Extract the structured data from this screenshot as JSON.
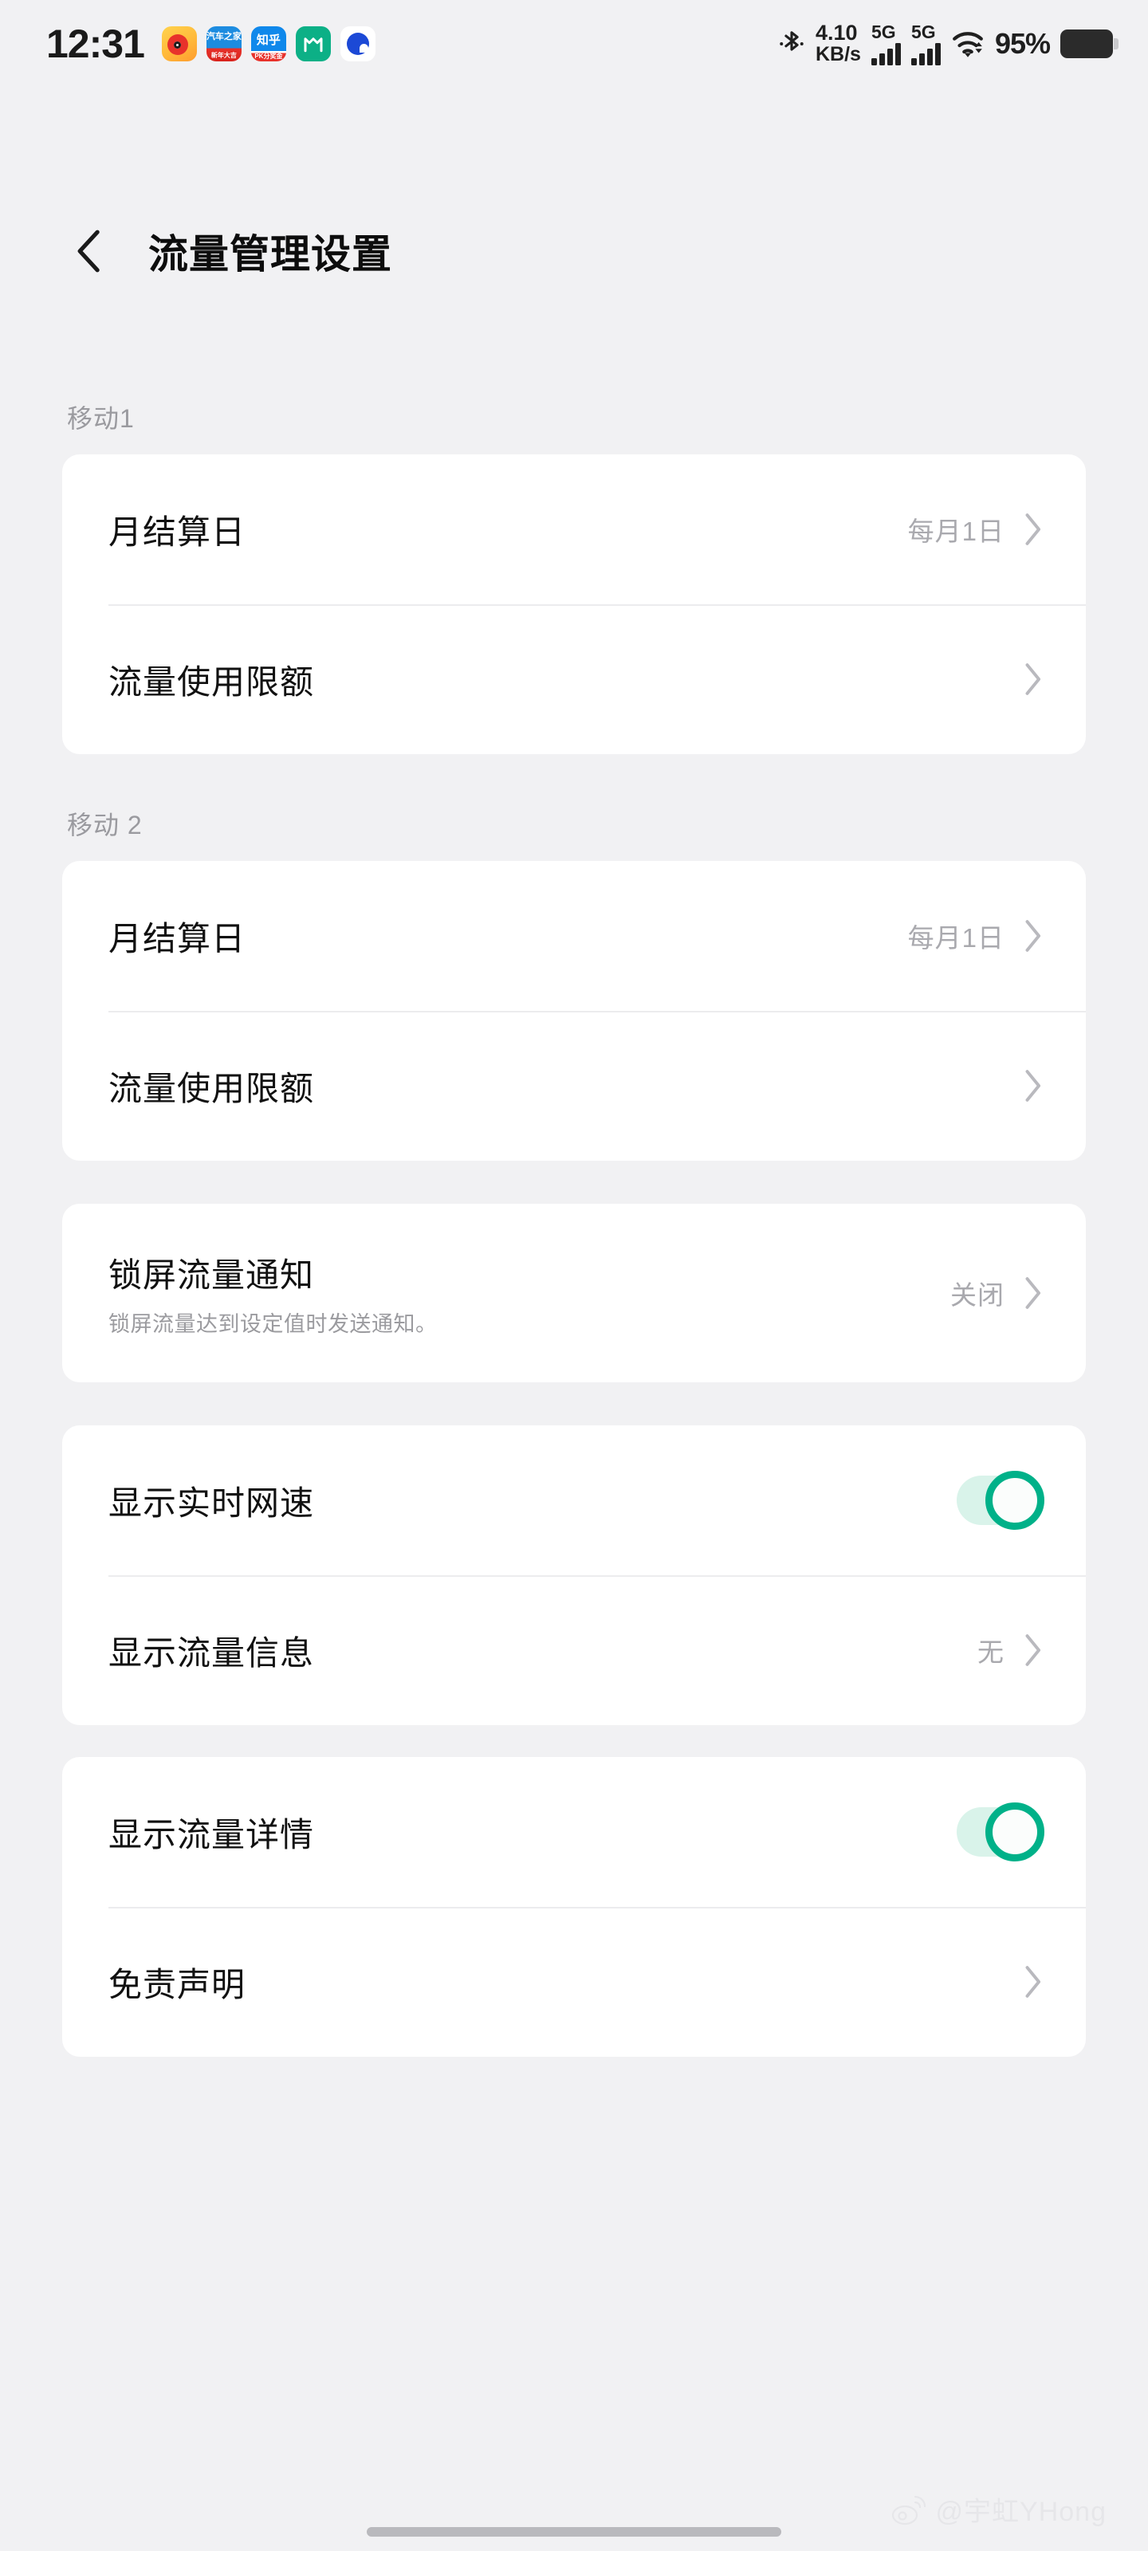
{
  "statusbar": {
    "time": "12:31",
    "notification_icons": [
      {
        "name": "weibo-app-icon",
        "label": ""
      },
      {
        "name": "autohome-app-icon",
        "label_top": "汽车之家",
        "label_bottom": "新年大吉"
      },
      {
        "name": "zhihu-app-icon",
        "label_top": "知乎",
        "label_bottom": "PK分奖金"
      },
      {
        "name": "mihome-app-icon",
        "label": ""
      },
      {
        "name": "browser-app-icon",
        "label": ""
      }
    ],
    "bluetooth": "bluetooth-icon",
    "network_speed_value": "4.10",
    "network_speed_unit": "KB/s",
    "sim1_network": "5G",
    "sim2_network": "5G",
    "wifi": "wifi-icon",
    "battery_percent": "95%"
  },
  "header": {
    "back": "back-chevron",
    "title": "流量管理设置"
  },
  "sections": [
    {
      "label": "移动1",
      "rows": [
        {
          "title": "月结算日",
          "value": "每月1日",
          "type": "link"
        },
        {
          "title": "流量使用限额",
          "value": "",
          "type": "link"
        }
      ]
    },
    {
      "label": "移动 2",
      "rows": [
        {
          "title": "月结算日",
          "value": "每月1日",
          "type": "link"
        },
        {
          "title": "流量使用限额",
          "value": "",
          "type": "link"
        }
      ]
    },
    {
      "label": "",
      "rows": [
        {
          "title": "锁屏流量通知",
          "subtitle": "锁屏流量达到设定值时发送通知。",
          "value": "关闭",
          "type": "link"
        }
      ]
    },
    {
      "label": "",
      "rows": [
        {
          "title": "显示实时网速",
          "value": "",
          "type": "toggle",
          "toggle_on": true
        },
        {
          "title": "显示流量信息",
          "value": "无",
          "type": "link"
        }
      ]
    },
    {
      "label": "",
      "rows": [
        {
          "title": "显示流量详情",
          "value": "",
          "type": "toggle",
          "toggle_on": true
        },
        {
          "title": "免责声明",
          "value": "",
          "type": "link"
        }
      ]
    }
  ],
  "watermark": {
    "logo": "weibo-logo",
    "text": "@宇虹YHong"
  },
  "colors": {
    "background": "#f1f1f3",
    "card": "#ffffff",
    "accent_green": "#00b189",
    "toggle_track": "#d9f3ea",
    "title_text": "#111111",
    "secondary_text": "#a9a9ae"
  }
}
